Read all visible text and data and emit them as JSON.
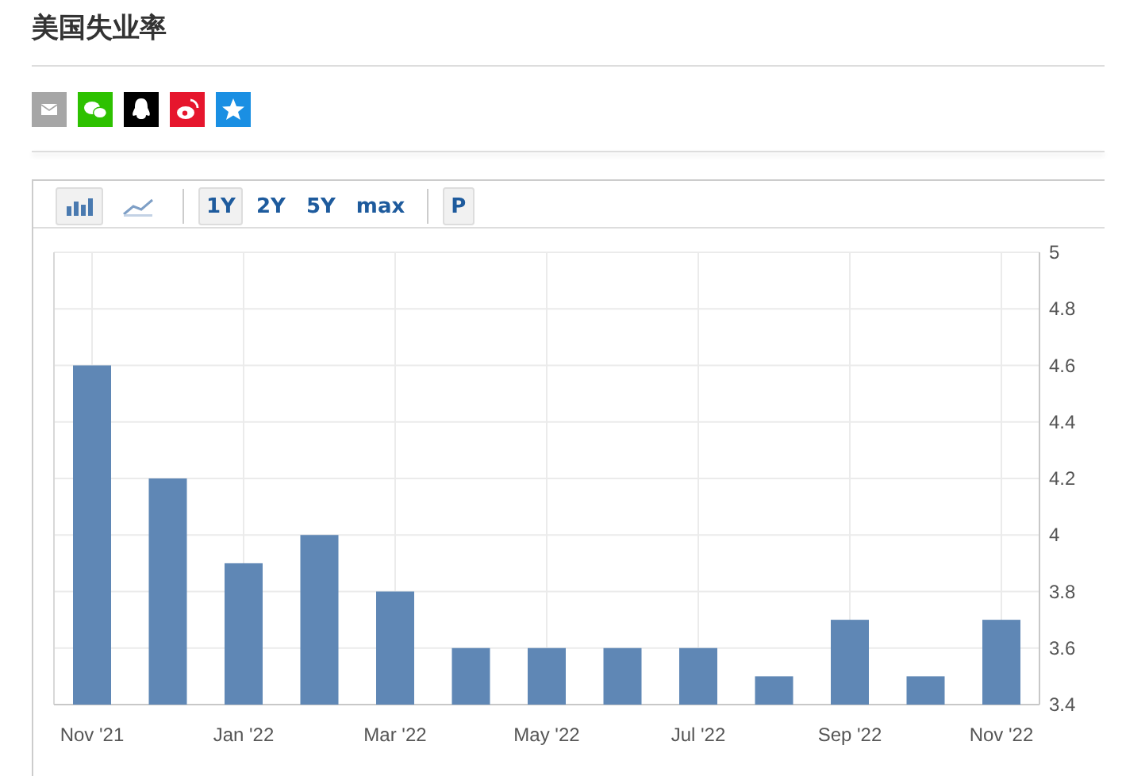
{
  "title": "美国失业率",
  "share": [
    {
      "kind": "email",
      "color": "#a6a6a6"
    },
    {
      "kind": "wechat",
      "color": "#2dc100"
    },
    {
      "kind": "qq",
      "color": "#000000"
    },
    {
      "kind": "weibo",
      "color": "#e6162d"
    },
    {
      "kind": "qzone",
      "color": "#1a8fe3"
    }
  ],
  "toolbar": {
    "chart_types": [
      {
        "kind": "bar",
        "selected": true
      },
      {
        "kind": "line",
        "selected": false
      }
    ],
    "ranges": [
      {
        "label": "1Y",
        "selected": true
      },
      {
        "label": "2Y",
        "selected": false
      },
      {
        "label": "5Y",
        "selected": false
      },
      {
        "label": "max",
        "selected": false
      }
    ],
    "extra_button": "P"
  },
  "chart_data": {
    "type": "bar",
    "categories": [
      "Nov '21",
      null,
      "Jan '22",
      null,
      "Mar '22",
      null,
      "May '22",
      null,
      "Jul '22",
      null,
      "Sep '22",
      null,
      "Nov '22"
    ],
    "series": [
      {
        "color": "#5f87b5",
        "values": [
          4.6,
          4.2,
          3.9,
          4.0,
          3.8,
          3.6,
          3.6,
          3.6,
          3.6,
          3.5,
          3.7,
          3.5,
          3.7
        ]
      }
    ],
    "grid": true,
    "ylim": [
      3.4,
      5
    ],
    "yticks": [
      3.4,
      3.6,
      3.8,
      4,
      4.2,
      4.4,
      4.6,
      4.8,
      5
    ]
  }
}
